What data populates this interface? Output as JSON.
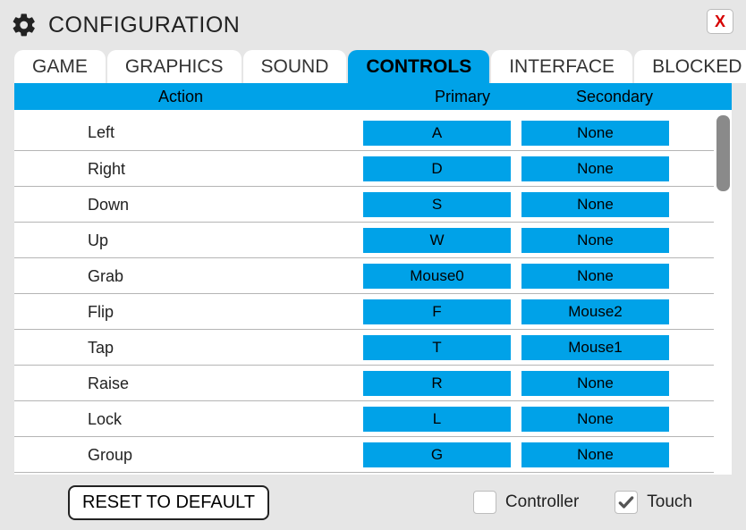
{
  "title": "CONFIGURATION",
  "close_label": "X",
  "tabs": [
    {
      "label": "GAME",
      "active": false
    },
    {
      "label": "GRAPHICS",
      "active": false
    },
    {
      "label": "SOUND",
      "active": false
    },
    {
      "label": "CONTROLS",
      "active": true
    },
    {
      "label": "INTERFACE",
      "active": false
    },
    {
      "label": "BLOCKED",
      "active": false
    }
  ],
  "columns": {
    "action": "Action",
    "primary": "Primary",
    "secondary": "Secondary"
  },
  "bindings": [
    {
      "action": "Left",
      "primary": "A",
      "secondary": "None"
    },
    {
      "action": "Right",
      "primary": "D",
      "secondary": "None"
    },
    {
      "action": "Down",
      "primary": "S",
      "secondary": "None"
    },
    {
      "action": "Up",
      "primary": "W",
      "secondary": "None"
    },
    {
      "action": "Grab",
      "primary": "Mouse0",
      "secondary": "None"
    },
    {
      "action": "Flip",
      "primary": "F",
      "secondary": "Mouse2"
    },
    {
      "action": "Tap",
      "primary": "T",
      "secondary": "Mouse1"
    },
    {
      "action": "Raise",
      "primary": "R",
      "secondary": "None"
    },
    {
      "action": "Lock",
      "primary": "L",
      "secondary": "None"
    },
    {
      "action": "Group",
      "primary": "G",
      "secondary": "None"
    }
  ],
  "footer": {
    "reset": "RESET TO DEFAULT",
    "controller": {
      "label": "Controller",
      "checked": false
    },
    "touch": {
      "label": "Touch",
      "checked": true
    }
  },
  "colors": {
    "accent": "#00a2e8",
    "bg": "#e6e6e6",
    "close": "#d60000",
    "scroll_thumb": "#8a8a8a"
  }
}
